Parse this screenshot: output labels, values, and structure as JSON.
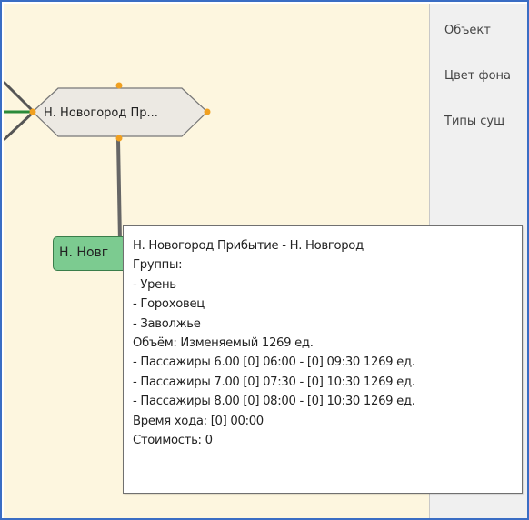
{
  "properties": {
    "object_label": "Объект",
    "bg_color_label": "Цвет фона",
    "entity_types_label": "Типы сущ"
  },
  "nodes": {
    "hex_label": "Н. Новогород Пр...",
    "rect_label": "Н. Новг"
  },
  "tooltip": {
    "title": "Н. Новогород Прибытие - Н. Новгород",
    "groups_header": "Группы:",
    "group_1": "- Урень",
    "group_2": "- Гороховец",
    "group_3": "- Заволжье",
    "volume": "Объём: Изменяемый 1269 ед.",
    "passenger_1": "- Пассажиры 6.00 [0] 06:00 - [0] 09:30 1269 ед.",
    "passenger_2": "- Пассажиры 7.00 [0] 07:30 - [0] 10:30 1269 ед.",
    "passenger_3": "- Пассажиры 8.00 [0] 08:00 - [0] 10:30 1269 ед.",
    "travel_time": "Время хода: [0] 00:00",
    "cost": "Стоимость: 0"
  },
  "colors": {
    "canvas_bg": "#fdf6df",
    "panel_bg": "#f0f0f0",
    "frame_border": "#3a6dc4",
    "rect_node_fill": "#7ccb90",
    "hex_node_fill": "#ece9e3",
    "handle": "#f0a020",
    "edge_green": "#2a8a3a"
  }
}
